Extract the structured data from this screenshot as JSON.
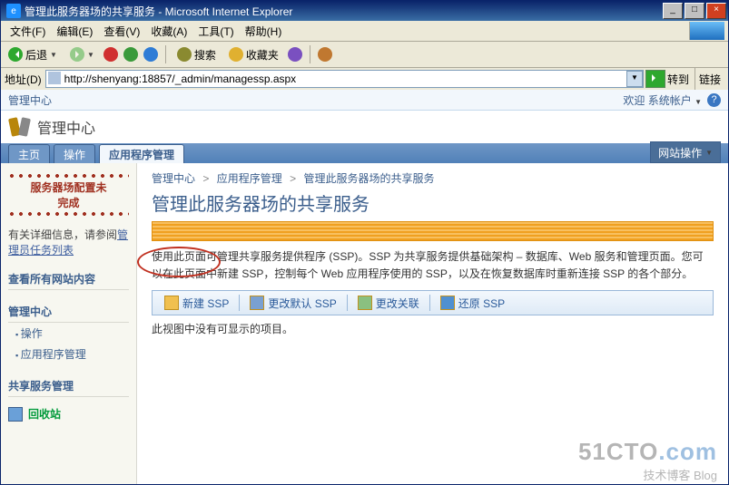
{
  "window": {
    "title": "管理此服务器场的共享服务 - Microsoft Internet Explorer",
    "min": "_",
    "max": "□",
    "close": "×"
  },
  "menu": {
    "file": "文件(F)",
    "edit": "编辑(E)",
    "view": "查看(V)",
    "favorites": "收藏(A)",
    "tools": "工具(T)",
    "help": "帮助(H)"
  },
  "toolbar": {
    "back": "后退",
    "search": "搜索",
    "favorites": "收藏夹"
  },
  "addressbar": {
    "label": "地址(D)",
    "url": "http://shenyang:18857/_admin/managessp.aspx",
    "go": "转到",
    "links": "链接"
  },
  "ribbon": {
    "left": "管理中心",
    "welcome": "欢迎 系统帐户"
  },
  "header": {
    "title": "管理中心"
  },
  "tabs": {
    "home": "主页",
    "operations": "操作",
    "appmgmt": "应用程序管理",
    "siteactions": "网站操作"
  },
  "left": {
    "red1": "服务器场配置未",
    "red2": "完成",
    "note_pre": "有关详细信息，请参阅",
    "note_link": "管理员任务列表",
    "view_all": "查看所有网站内容",
    "nav1_hdr": "管理中心",
    "nav1_a": "操作",
    "nav1_b": "应用程序管理",
    "nav2_hdr": "共享服务管理",
    "recycle": "回收站"
  },
  "crumb": {
    "a": "管理中心",
    "b": "应用程序管理",
    "c": "管理此服务器场的共享服务"
  },
  "page": {
    "title": "管理此服务器场的共享服务",
    "desc": "使用此页面可管理共享服务提供程序 (SSP)。SSP 为共享服务提供基础架构 – 数据库、Web 服务和管理页面。您可以在此页面中新建 SSP，控制每个 Web 应用程序使用的 SSP，以及在恢复数据库时重新连接 SSP 的各个部分。",
    "empty": "此视图中没有可显示的项目。"
  },
  "actions": {
    "new": "新建 SSP",
    "default": "更改默认 SSP",
    "assoc": "更改关联",
    "restore": "还原 SSP"
  },
  "watermark": {
    "line1a": "51CTO",
    "line1b": ".com",
    "line2": "技术博客    Blog"
  }
}
